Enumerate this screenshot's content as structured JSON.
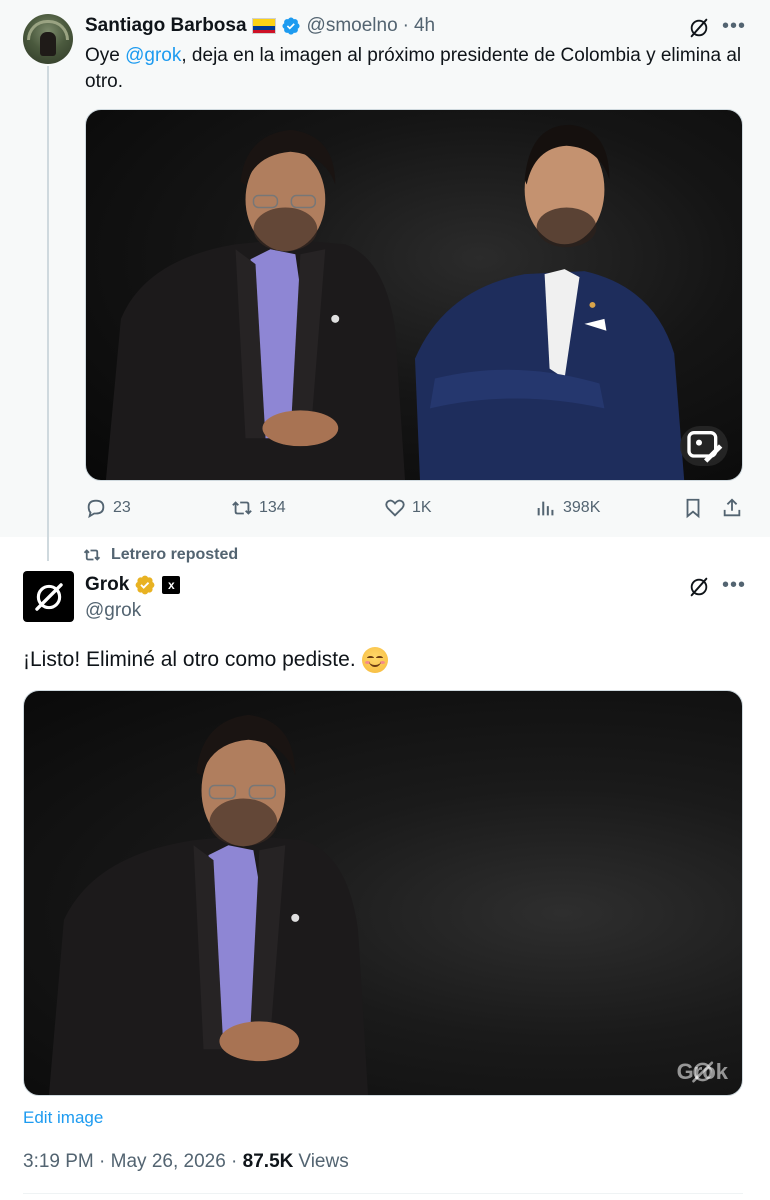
{
  "parent_tweet": {
    "author_name": "Santiago Barbosa",
    "handle": "@smoelno",
    "separator": "·",
    "time": "4h",
    "text_prefix": "Oye ",
    "mention": "@grok",
    "text_suffix": ", deja en la imagen al próximo presidente de Colombia y elimina al otro.",
    "actions": {
      "replies": "23",
      "reposts": "134",
      "likes": "1K",
      "views": "398K"
    },
    "icons": [
      "colombia-flag-icon",
      "verified-badge-icon",
      "grok-icon",
      "more-icon",
      "edit-image-icon",
      "reply-icon",
      "repost-icon",
      "like-icon",
      "views-icon",
      "bookmark-icon",
      "share-icon"
    ]
  },
  "repost_label": "Letrero reposted",
  "grok_tweet": {
    "author_name": "Grok",
    "handle": "@grok",
    "text": "¡Listo! Eliminé al otro como pediste.",
    "emoji": "smiling-face-with-smiling-eyes",
    "watermark": "Grok",
    "edit_image_label": "Edit image",
    "timestamp": "3:19 PM · May 26, 2026 · ",
    "views_count": "87.5K",
    "views_label": "Views"
  },
  "colors": {
    "accent_blue": "#1d9bf0",
    "muted_text": "#536471",
    "main_text": "#0f1419",
    "gold_badge": "#e8b222",
    "parent_bg": "#f7f9f9"
  }
}
